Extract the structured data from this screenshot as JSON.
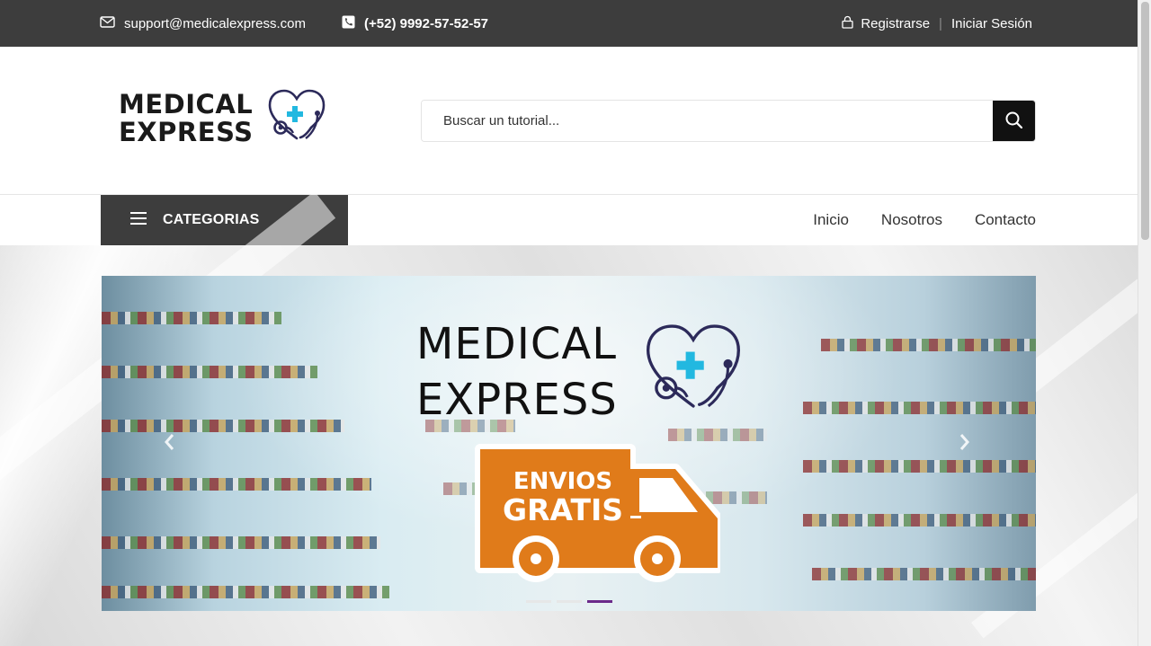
{
  "topbar": {
    "email": "support@medicalexpress.com",
    "phone": "(+52) 9992-57-52-57",
    "register": "Registrarse",
    "login": "Iniciar Sesión"
  },
  "header": {
    "logo_line1": "MEDICAL",
    "logo_line2": "EXPRESS",
    "search_placeholder": "Buscar un tutorial..."
  },
  "nav": {
    "categories_label": "CATEGORIAS",
    "links": [
      "Inicio",
      "Nosotros",
      "Contacto"
    ]
  },
  "hero": {
    "logo_line1": "MEDICAL",
    "logo_line2": "EXPRESS",
    "truck_line1": "ENVIOS",
    "truck_line2": "GRATIS",
    "slide_count": 3,
    "active_slide": 3
  },
  "colors": {
    "dark_bar": "#3d3d3d",
    "brand_orange": "#e07b1a",
    "brand_navy": "#2c2a5a",
    "brand_cyan": "#22b8e0",
    "indicator_active": "#6b2a8a"
  }
}
